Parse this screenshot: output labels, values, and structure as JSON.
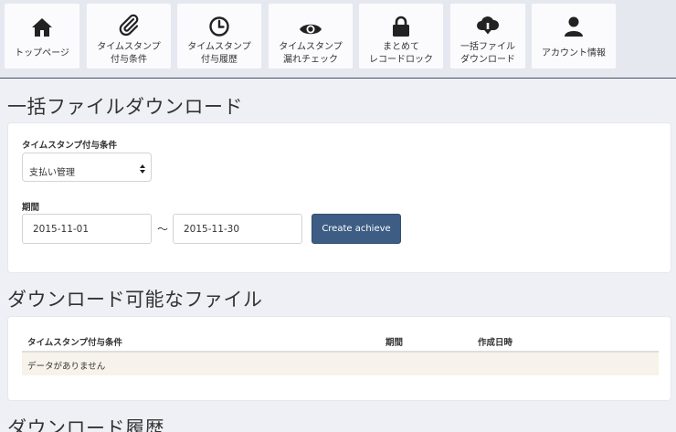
{
  "nav": {
    "items": [
      {
        "label": "トップページ",
        "icon": "home-icon"
      },
      {
        "label": "タイムスタンプ\n付与条件",
        "icon": "paperclip-icon"
      },
      {
        "label": "タイムスタンプ\n付与履歴",
        "icon": "clock-icon"
      },
      {
        "label": "タイムスタンプ\n漏れチェック",
        "icon": "eye-icon"
      },
      {
        "label": "まとめて\nレコードロック",
        "icon": "lock-icon"
      },
      {
        "label": "一括ファイル\nダウンロード",
        "icon": "cloud-download-icon"
      },
      {
        "label": "アカウント情報",
        "icon": "user-icon"
      }
    ]
  },
  "bulk": {
    "title": "一括ファイルダウンロード",
    "condition_label": "タイムスタンプ付与条件",
    "condition_value": "支払い管理",
    "period_label": "期間",
    "start_date": "2015-11-01",
    "separator": "〜",
    "end_date": "2015-11-30",
    "create_button": "Create achieve"
  },
  "files": {
    "title": "ダウンロード可能なファイル",
    "columns": [
      "タイムスタンプ付与条件",
      "期間",
      "作成日時"
    ],
    "empty_text": "データがありません"
  },
  "history": {
    "title": "ダウンロード履歴"
  },
  "colors": {
    "primary_button": "#3d5d85",
    "empty_row_bg": "#f7f3ea",
    "nav_bar_bg": "#e6e8f0"
  }
}
